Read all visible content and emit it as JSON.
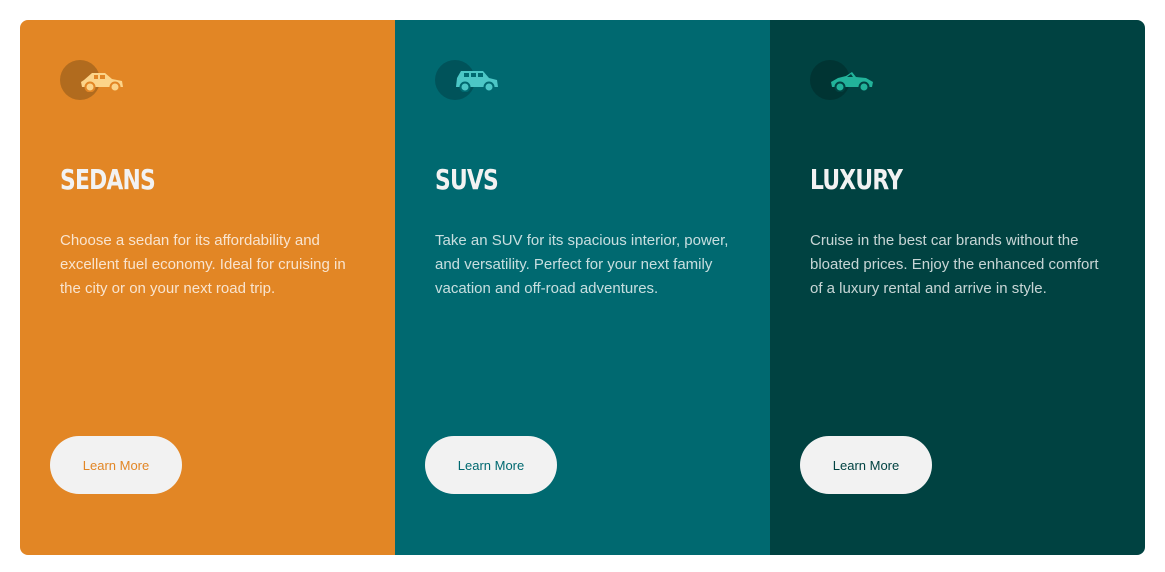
{
  "colors": {
    "sedans_bg": "#e28625",
    "suvs_bg": "#006970",
    "luxury_bg": "#004241",
    "sedans_disc": "#b16b1e",
    "suvs_disc": "#00535a",
    "luxury_disc": "#003433",
    "sedans_icon": "#fcd489",
    "suvs_icon": "#4cc7c6",
    "luxury_icon": "#22b39a",
    "button_bg": "#f2f2f2",
    "heading": "#f2f2f2"
  },
  "cards": [
    {
      "icon": "sedan-car-icon",
      "title": "SEDANS",
      "description": "Choose a sedan for its affordability and excellent fuel economy. Ideal for cruising in the city or on your next road trip.",
      "button_label": "Learn More"
    },
    {
      "icon": "suv-car-icon",
      "title": "SUVS",
      "description": "Take an SUV for its spacious interior, power, and versatility. Perfect for your next family vacation and off-road adventures.",
      "button_label": "Learn More"
    },
    {
      "icon": "luxury-car-icon",
      "title": "LUXURY",
      "description": "Cruise in the best car brands without the bloated prices. Enjoy the enhanced comfort of a luxury rental and arrive in style.",
      "button_label": "Learn More"
    }
  ]
}
